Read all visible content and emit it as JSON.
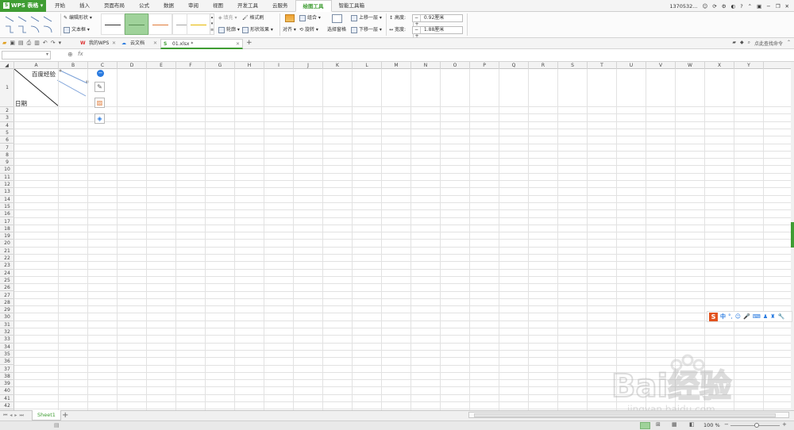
{
  "app": {
    "name": "WPS 表格",
    "logo_glyph": "S"
  },
  "tabs": [
    "开始",
    "插入",
    "页面布局",
    "公式",
    "数据",
    "审阅",
    "视图",
    "开发工具",
    "云服务",
    "绘图工具",
    "智能工具箱"
  ],
  "active_tab": "绘图工具",
  "account": {
    "user": "1370532..."
  },
  "ribbon": {
    "edit_shape": "编辑形状",
    "text_box": "文本框",
    "fill": "填充",
    "format_brush": "格式刷",
    "outline": "轮廓",
    "shape_effect": "形状效果",
    "align": "对齐",
    "group": "组合",
    "rotate": "旋转",
    "select_pane": "选择窗格",
    "bring_forward": "上移一层",
    "send_backward": "下移一层",
    "height_label": "高度:",
    "height_value": "0.92厘米",
    "width_label": "宽度:",
    "width_value": "1.88厘米",
    "minus": "−",
    "plus": "+"
  },
  "doc_tabs": [
    {
      "label": "我的WPS"
    },
    {
      "label": "云文档"
    },
    {
      "label": "01.xlsx *"
    }
  ],
  "search_hint": "点此查找命令",
  "formula": {
    "fx": "fx"
  },
  "columns": [
    "A",
    "B",
    "C",
    "D",
    "E",
    "F",
    "G",
    "H",
    "I",
    "J",
    "K",
    "L",
    "M",
    "N",
    "O",
    "P",
    "Q",
    "R",
    "S",
    "T",
    "U",
    "V",
    "W",
    "X",
    "Y"
  ],
  "rows": [
    "1",
    "2",
    "3",
    "4",
    "5",
    "6",
    "7",
    "8",
    "9",
    "10",
    "11",
    "12",
    "13",
    "14",
    "15",
    "16",
    "17",
    "18",
    "19",
    "20",
    "21",
    "22",
    "23",
    "24",
    "25",
    "26",
    "27",
    "28",
    "29",
    "30",
    "31",
    "32",
    "33",
    "34",
    "35",
    "36",
    "37",
    "38",
    "39",
    "40",
    "41",
    "42"
  ],
  "cells": {
    "a1_top": "百度经验",
    "a1_bottom": "日期"
  },
  "sheet": {
    "name": "Sheet1",
    "add": "+"
  },
  "status": {
    "zoom": "100 %"
  },
  "ime": {
    "lang": "中"
  },
  "watermark": {
    "text": "Bai经验",
    "url": "jingyan.baidu.com"
  },
  "colors": {
    "accent": "#3f9d33",
    "selected_swatch": "#9fd29a"
  }
}
